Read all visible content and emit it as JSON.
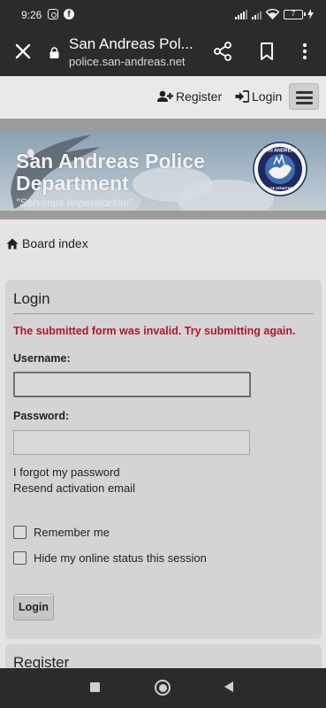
{
  "status_bar": {
    "time": "9:26",
    "battery": "7"
  },
  "browser": {
    "title": "San Andreas Pol...",
    "url": "police.san-andreas.net"
  },
  "navbar": {
    "register_label": "Register",
    "login_label": "Login"
  },
  "banner": {
    "title": "San Andreas Police Department",
    "motto": "\"Servimus Imperatorium\"",
    "seal_top_text": "SAN ANDREAS",
    "seal_bottom_text": "POLICE DEPARTMENT"
  },
  "breadcrumb": {
    "label": "Board index"
  },
  "login_panel": {
    "title": "Login",
    "error": "The submitted form was invalid. Try submitting again.",
    "username_label": "Username:",
    "username_value": "",
    "password_label": "Password:",
    "password_value": "",
    "forgot_link": "I forgot my password",
    "resend_link": "Resend activation email",
    "remember_label": "Remember me",
    "remember_checked": false,
    "hide_status_label": "Hide my online status this session",
    "hide_status_checked": false,
    "submit_label": "Login"
  },
  "register_panel": {
    "title": "Register"
  },
  "colors": {
    "error": "#b0172d",
    "chrome": "#2b2b2b"
  }
}
